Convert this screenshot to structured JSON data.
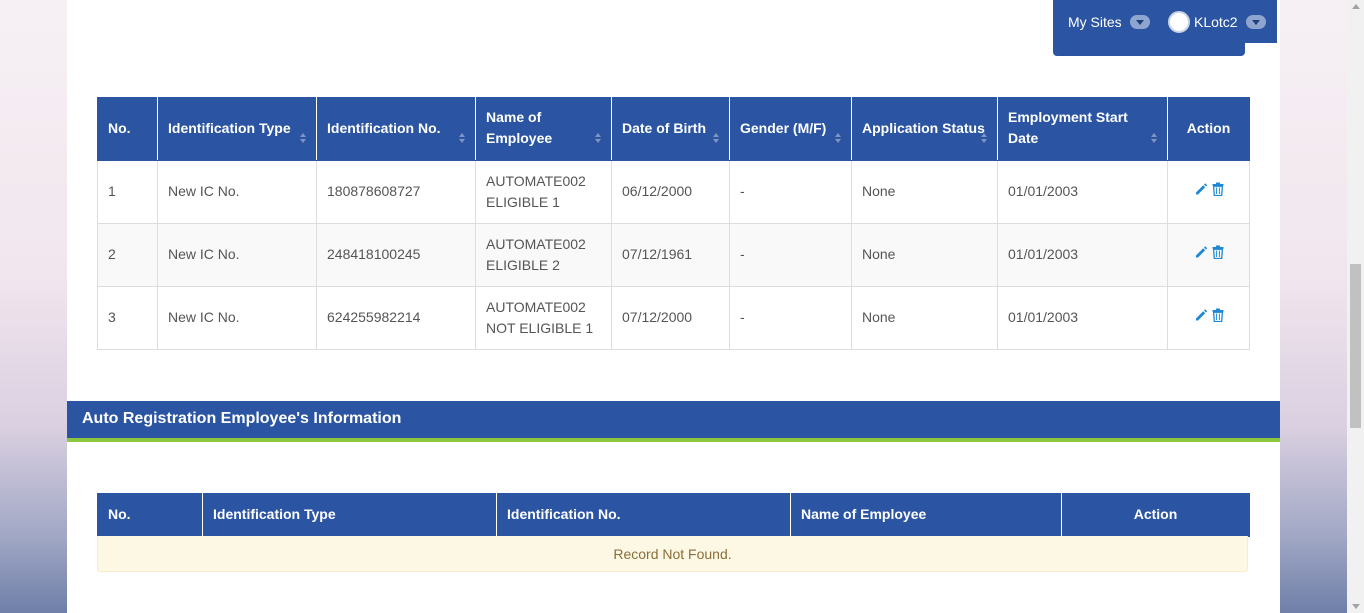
{
  "userbar": {
    "my_sites": "My Sites",
    "username": "KLotc2"
  },
  "employee_table": {
    "headers": [
      {
        "label": "No.",
        "sortable": false
      },
      {
        "label": "Identification Type",
        "sortable": true
      },
      {
        "label": "Identification No.",
        "sortable": true
      },
      {
        "label": "Name of Employee",
        "sortable": true
      },
      {
        "label": "Date of Birth",
        "sortable": true
      },
      {
        "label": "Gender (M/F)",
        "sortable": true
      },
      {
        "label": "Application Status",
        "sortable": true
      },
      {
        "label": "Employment Start Date",
        "sortable": true
      },
      {
        "label": "Action",
        "sortable": false
      }
    ],
    "rows": [
      {
        "no": "1",
        "id_type": "New IC No.",
        "id_no": "180878608727",
        "name": "AUTOMATE002 ELIGIBLE 1",
        "dob": "06/12/2000",
        "gender": "-",
        "status": "None",
        "start_date": "01/01/2003"
      },
      {
        "no": "2",
        "id_type": "New IC No.",
        "id_no": "248418100245",
        "name": "AUTOMATE002 ELIGIBLE 2",
        "dob": "07/12/1961",
        "gender": "-",
        "status": "None",
        "start_date": "01/01/2003"
      },
      {
        "no": "3",
        "id_type": "New IC No.",
        "id_no": "624255982214",
        "name": "AUTOMATE002 NOT ELIGIBLE 1",
        "dob": "07/12/2000",
        "gender": "-",
        "status": "None",
        "start_date": "01/01/2003"
      }
    ]
  },
  "auto_registration": {
    "title": "Auto Registration Employee's Information",
    "headers": [
      "No.",
      "Identification Type",
      "Identification No.",
      "Name of Employee",
      "Action"
    ],
    "empty_message": "Record Not Found."
  },
  "icons": {
    "edit": "pencil-icon",
    "delete": "trash-icon"
  },
  "colors": {
    "header_blue": "#2b55a3",
    "accent_green": "#8dc63f",
    "icon_blue": "#1e88d6"
  }
}
